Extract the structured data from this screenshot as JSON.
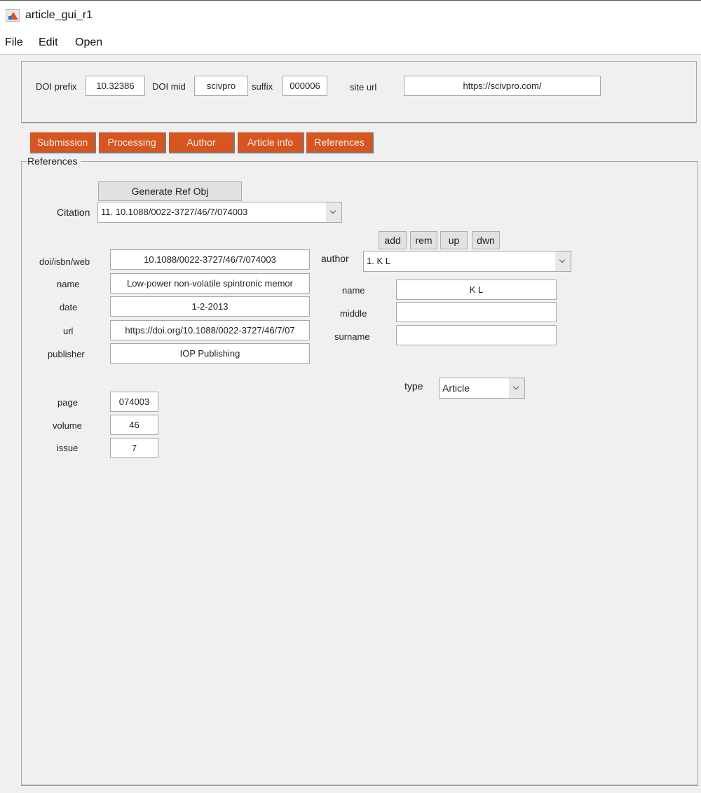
{
  "window": {
    "title": "article_gui_r1",
    "icon": "matlab-icon"
  },
  "menu": [
    "File",
    "Edit",
    "Open"
  ],
  "doi": {
    "prefix_label": "DOI prefix",
    "prefix_value": "10.32386",
    "mid_label": "DOI mid",
    "mid_value": "scivpro",
    "suffix_label": "suffix",
    "suffix_value": "000006",
    "site_label": "site url",
    "site_value": "https://scivpro.com/"
  },
  "tabs": [
    {
      "label": "Submission"
    },
    {
      "label": "Processing"
    },
    {
      "label": "Author"
    },
    {
      "label": "Article info"
    },
    {
      "label": "References"
    }
  ],
  "tab_color": "#d65521",
  "references": {
    "group_title": "References",
    "generate_button": "Generate Ref Obj",
    "citation_label": "Citation",
    "citation_value": "11. 10.1088/0022-3727/46/7/074003",
    "fields": [
      {
        "label": "doi/isbn/web",
        "value": "10.1088/0022-3727/46/7/074003"
      },
      {
        "label": "name",
        "value": "Low-power non-volatile spintronic memor"
      },
      {
        "label": "date",
        "value": "1-2-2013"
      },
      {
        "label": "url",
        "value": "https://doi.org/10.1088/0022-3727/46/7/07"
      },
      {
        "label": "publisher",
        "value": "IOP Publishing"
      }
    ],
    "numbers": [
      {
        "label": "page",
        "value": "074003"
      },
      {
        "label": "volume",
        "value": "46"
      },
      {
        "label": "issue",
        "value": "7"
      }
    ],
    "author_buttons": [
      "add",
      "rem",
      "up",
      "dwn"
    ],
    "author_label": "author",
    "author_value": "1. K L",
    "author_fields": [
      {
        "label": "name",
        "value": "K L"
      },
      {
        "label": "middle",
        "value": ""
      },
      {
        "label": "surname",
        "value": ""
      }
    ],
    "type_label": "type",
    "type_value": "Article"
  }
}
